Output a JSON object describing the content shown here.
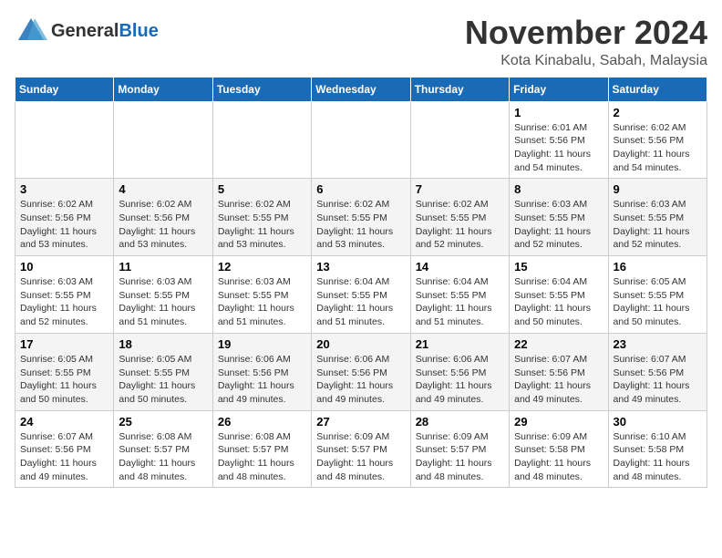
{
  "header": {
    "logo_general": "General",
    "logo_blue": "Blue",
    "month": "November 2024",
    "location": "Kota Kinabalu, Sabah, Malaysia"
  },
  "weekdays": [
    "Sunday",
    "Monday",
    "Tuesday",
    "Wednesday",
    "Thursday",
    "Friday",
    "Saturday"
  ],
  "weeks": [
    [
      {
        "day": "",
        "info": ""
      },
      {
        "day": "",
        "info": ""
      },
      {
        "day": "",
        "info": ""
      },
      {
        "day": "",
        "info": ""
      },
      {
        "day": "",
        "info": ""
      },
      {
        "day": "1",
        "info": "Sunrise: 6:01 AM\nSunset: 5:56 PM\nDaylight: 11 hours\nand 54 minutes."
      },
      {
        "day": "2",
        "info": "Sunrise: 6:02 AM\nSunset: 5:56 PM\nDaylight: 11 hours\nand 54 minutes."
      }
    ],
    [
      {
        "day": "3",
        "info": "Sunrise: 6:02 AM\nSunset: 5:56 PM\nDaylight: 11 hours\nand 53 minutes."
      },
      {
        "day": "4",
        "info": "Sunrise: 6:02 AM\nSunset: 5:56 PM\nDaylight: 11 hours\nand 53 minutes."
      },
      {
        "day": "5",
        "info": "Sunrise: 6:02 AM\nSunset: 5:55 PM\nDaylight: 11 hours\nand 53 minutes."
      },
      {
        "day": "6",
        "info": "Sunrise: 6:02 AM\nSunset: 5:55 PM\nDaylight: 11 hours\nand 53 minutes."
      },
      {
        "day": "7",
        "info": "Sunrise: 6:02 AM\nSunset: 5:55 PM\nDaylight: 11 hours\nand 52 minutes."
      },
      {
        "day": "8",
        "info": "Sunrise: 6:03 AM\nSunset: 5:55 PM\nDaylight: 11 hours\nand 52 minutes."
      },
      {
        "day": "9",
        "info": "Sunrise: 6:03 AM\nSunset: 5:55 PM\nDaylight: 11 hours\nand 52 minutes."
      }
    ],
    [
      {
        "day": "10",
        "info": "Sunrise: 6:03 AM\nSunset: 5:55 PM\nDaylight: 11 hours\nand 52 minutes."
      },
      {
        "day": "11",
        "info": "Sunrise: 6:03 AM\nSunset: 5:55 PM\nDaylight: 11 hours\nand 51 minutes."
      },
      {
        "day": "12",
        "info": "Sunrise: 6:03 AM\nSunset: 5:55 PM\nDaylight: 11 hours\nand 51 minutes."
      },
      {
        "day": "13",
        "info": "Sunrise: 6:04 AM\nSunset: 5:55 PM\nDaylight: 11 hours\nand 51 minutes."
      },
      {
        "day": "14",
        "info": "Sunrise: 6:04 AM\nSunset: 5:55 PM\nDaylight: 11 hours\nand 51 minutes."
      },
      {
        "day": "15",
        "info": "Sunrise: 6:04 AM\nSunset: 5:55 PM\nDaylight: 11 hours\nand 50 minutes."
      },
      {
        "day": "16",
        "info": "Sunrise: 6:05 AM\nSunset: 5:55 PM\nDaylight: 11 hours\nand 50 minutes."
      }
    ],
    [
      {
        "day": "17",
        "info": "Sunrise: 6:05 AM\nSunset: 5:55 PM\nDaylight: 11 hours\nand 50 minutes."
      },
      {
        "day": "18",
        "info": "Sunrise: 6:05 AM\nSunset: 5:55 PM\nDaylight: 11 hours\nand 50 minutes."
      },
      {
        "day": "19",
        "info": "Sunrise: 6:06 AM\nSunset: 5:56 PM\nDaylight: 11 hours\nand 49 minutes."
      },
      {
        "day": "20",
        "info": "Sunrise: 6:06 AM\nSunset: 5:56 PM\nDaylight: 11 hours\nand 49 minutes."
      },
      {
        "day": "21",
        "info": "Sunrise: 6:06 AM\nSunset: 5:56 PM\nDaylight: 11 hours\nand 49 minutes."
      },
      {
        "day": "22",
        "info": "Sunrise: 6:07 AM\nSunset: 5:56 PM\nDaylight: 11 hours\nand 49 minutes."
      },
      {
        "day": "23",
        "info": "Sunrise: 6:07 AM\nSunset: 5:56 PM\nDaylight: 11 hours\nand 49 minutes."
      }
    ],
    [
      {
        "day": "24",
        "info": "Sunrise: 6:07 AM\nSunset: 5:56 PM\nDaylight: 11 hours\nand 49 minutes."
      },
      {
        "day": "25",
        "info": "Sunrise: 6:08 AM\nSunset: 5:57 PM\nDaylight: 11 hours\nand 48 minutes."
      },
      {
        "day": "26",
        "info": "Sunrise: 6:08 AM\nSunset: 5:57 PM\nDaylight: 11 hours\nand 48 minutes."
      },
      {
        "day": "27",
        "info": "Sunrise: 6:09 AM\nSunset: 5:57 PM\nDaylight: 11 hours\nand 48 minutes."
      },
      {
        "day": "28",
        "info": "Sunrise: 6:09 AM\nSunset: 5:57 PM\nDaylight: 11 hours\nand 48 minutes."
      },
      {
        "day": "29",
        "info": "Sunrise: 6:09 AM\nSunset: 5:58 PM\nDaylight: 11 hours\nand 48 minutes."
      },
      {
        "day": "30",
        "info": "Sunrise: 6:10 AM\nSunset: 5:58 PM\nDaylight: 11 hours\nand 48 minutes."
      }
    ]
  ]
}
